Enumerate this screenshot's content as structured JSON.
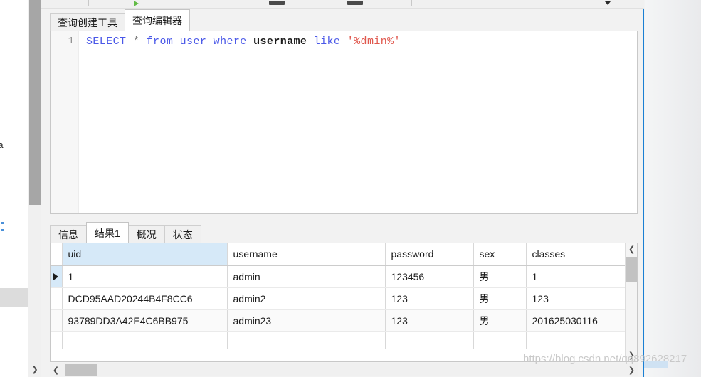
{
  "app": {
    "window_border_color": "#1a7fd4",
    "background": "#f2f2f2"
  },
  "tree_panel": {
    "partial_items": [
      {
        "label": "ema"
      },
      {
        "label": "hema"
      }
    ],
    "scroll": {
      "down_arrow": "chevron-down-icon"
    }
  },
  "toolbar": {
    "icons": [
      {
        "name": "run-query-icon",
        "glyph": "play"
      },
      {
        "name": "toolbar-bar-icon-1",
        "glyph": "bar"
      },
      {
        "name": "toolbar-bar-icon-2",
        "glyph": "bar"
      },
      {
        "name": "toolbar-caret-icon",
        "glyph": "caret"
      }
    ]
  },
  "query_tabs": {
    "items": [
      {
        "label": "查询创建工具",
        "active": false
      },
      {
        "label": "查询编辑器",
        "active": true
      }
    ]
  },
  "editor": {
    "line_number": "1",
    "sql_tokens": [
      {
        "text": "SELECT",
        "type": "kw"
      },
      {
        "text": " ",
        "type": "plain"
      },
      {
        "text": "*",
        "type": "star"
      },
      {
        "text": " ",
        "type": "plain"
      },
      {
        "text": "from",
        "type": "kw"
      },
      {
        "text": " ",
        "type": "plain"
      },
      {
        "text": "user",
        "type": "kw"
      },
      {
        "text": " ",
        "type": "plain"
      },
      {
        "text": "where",
        "type": "kw"
      },
      {
        "text": " ",
        "type": "plain"
      },
      {
        "text": "username",
        "type": "ident"
      },
      {
        "text": " ",
        "type": "plain"
      },
      {
        "text": "like",
        "type": "kw"
      },
      {
        "text": " ",
        "type": "plain"
      },
      {
        "text": "'%dmin%'",
        "type": "str"
      }
    ],
    "sql_full": "SELECT * from user where username like '%dmin%'"
  },
  "result_tabs": {
    "items": [
      {
        "label": "信息",
        "active": false
      },
      {
        "label": "结果1",
        "active": true
      },
      {
        "label": "概况",
        "active": false
      },
      {
        "label": "状态",
        "active": false
      }
    ]
  },
  "result_grid": {
    "columns": [
      {
        "key": "uid",
        "label": "uid",
        "selected": true
      },
      {
        "key": "username",
        "label": "username",
        "selected": false
      },
      {
        "key": "password",
        "label": "password",
        "selected": false
      },
      {
        "key": "sex",
        "label": "sex",
        "selected": false
      },
      {
        "key": "classes",
        "label": "classes",
        "selected": false
      }
    ],
    "rows": [
      {
        "current": true,
        "uid": "1",
        "username": "admin",
        "password": "123456",
        "sex": "男",
        "classes": "1"
      },
      {
        "current": false,
        "uid": "DCD95AAD20244B4F8CC6",
        "username": "admin2",
        "password": "123",
        "sex": "男",
        "classes": "123"
      },
      {
        "current": false,
        "uid": "93789DD3A42E4C6BB975",
        "username": "admin23",
        "password": "123",
        "sex": "男",
        "classes": "201625030116"
      }
    ],
    "vscroll": {
      "up": "chevron-up-icon",
      "down": "chevron-down-icon"
    },
    "hscroll": {
      "left": "chevron-left-icon",
      "right": "chevron-right-icon"
    }
  },
  "watermark": {
    "text": "https://blog.csdn.net/qq892628217"
  }
}
